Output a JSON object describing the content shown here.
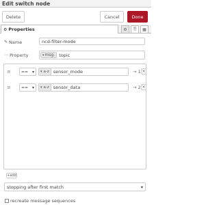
{
  "header": {
    "title": "Edit switch node"
  },
  "toolbar": {
    "delete_label": "Delete",
    "cancel_label": "Cancel",
    "done_label": "Done"
  },
  "tabs": {
    "properties_label": "Properties"
  },
  "form": {
    "name_label": "Name",
    "name_value": "ncd-filter-mode",
    "property_label": "Property",
    "property_type": "msg.",
    "property_value": "topic"
  },
  "rules": [
    {
      "operator": "==",
      "type": "a-z",
      "value": "sensor_mode",
      "output": "→ 1",
      "remove": "×"
    },
    {
      "operator": "==",
      "type": "a-z",
      "value": "sensor_data",
      "output": "→ 2",
      "remove": "×"
    }
  ],
  "add_label": "+add",
  "stop_select": {
    "value": "stopping after first match"
  },
  "recreate": {
    "label": "recreate message sequences",
    "checked": false
  },
  "icons": {
    "tag": "✎",
    "ellipsis": "⋯",
    "cog": "⚙",
    "grip": "≡",
    "chevron": "▾",
    "gear": "⚙",
    "doc": "🗎",
    "app": "▦"
  }
}
